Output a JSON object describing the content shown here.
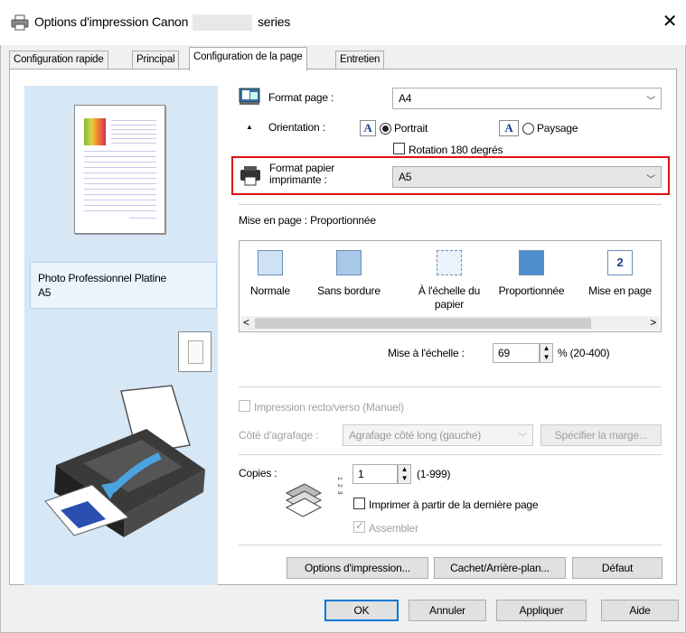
{
  "window": {
    "title": "Options d'impression Canon",
    "title_suffix": "series",
    "close_glyph": "✕"
  },
  "tabs": [
    {
      "label": "Configuration rapide"
    },
    {
      "label": "Principal"
    },
    {
      "label": "Configuration de la page"
    },
    {
      "label": "Entretien"
    }
  ],
  "preview": {
    "media_line1": "Photo Professionnel Platine",
    "media_line2": "A5"
  },
  "page_setup": {
    "page_size_label": "Format page :",
    "page_size_value": "A4",
    "orientation_label": "Orientation :",
    "portrait_label": "Portrait",
    "landscape_label": "Paysage",
    "rotate_label": "Rotation 180 degrés",
    "printer_paper_label_1": "Format papier",
    "printer_paper_label_2": "imprimante :",
    "printer_paper_value": "A5",
    "layout_label": "Mise en page :",
    "layout_value": "Proportionnée",
    "layouts": [
      {
        "label": "Normale",
        "label2": ""
      },
      {
        "label": "Sans bordure",
        "label2": ""
      },
      {
        "label": "À l'échelle du",
        "label2": "papier"
      },
      {
        "label": "Proportionnée",
        "label2": ""
      },
      {
        "label": "Mise en page",
        "label2": ""
      }
    ],
    "layout_icon_5_text": "2",
    "scale_label": "Mise à l'échelle :",
    "scale_value": "69",
    "scale_range": "% (20-400)",
    "duplex_label": "Impression recto/verso (Manuel)",
    "staple_label": "Côté d'agrafage :",
    "staple_value": "Agrafage côté long (gauche)",
    "margin_button": "Spécifier la marge...",
    "copies_label": "Copies :",
    "copies_value": "1",
    "copies_range": "(1-999)",
    "reverse_label": "Imprimer à partir de la dernière page",
    "collate_label": "Assembler",
    "print_options_button": "Options d'impression...",
    "stamp_button": "Cachet/Arrière-plan...",
    "default_button": "Défaut"
  },
  "footer": {
    "ok": "OK",
    "cancel": "Annuler",
    "apply": "Appliquer",
    "help": "Aide"
  },
  "colors": {
    "highlight": "#e01010",
    "preview_bg": "#d6e7f6",
    "accent": "#0078d7"
  }
}
